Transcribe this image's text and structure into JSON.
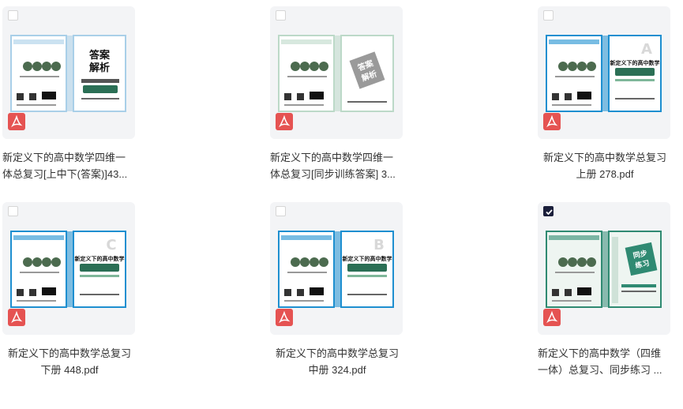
{
  "files": [
    {
      "line1": "新定义下的高中数学四维一",
      "line2": "体总复习[上中下(答案)]43...",
      "checked": false,
      "cover": "answer",
      "align": "left",
      "cover_title": [
        "答案",
        "解析"
      ],
      "cover_big": "",
      "border": "#a9cfe8",
      "back": "#ffffff"
    },
    {
      "line1": "新定义下的高中数学四维一",
      "line2": "体总复习[同步训练答案] 3...",
      "checked": false,
      "cover": "answer2",
      "align": "left",
      "cover_title": [
        "答案",
        "解析"
      ],
      "cover_big": "",
      "border": "#bcd9c8",
      "back": "#ffffff"
    },
    {
      "line1": "新定义下的高中数学总复习",
      "line2": "上册 278.pdf",
      "checked": false,
      "cover": "book",
      "align": "center",
      "cover_title": [
        "新定义下的高中数学"
      ],
      "cover_big": "A",
      "border": "#1e8fd0",
      "back": "#ffffff"
    },
    {
      "line1": "新定义下的高中数学总复习",
      "line2": "下册 448.pdf",
      "checked": false,
      "cover": "book",
      "align": "center",
      "cover_title": [
        "新定义下的高中数学"
      ],
      "cover_big": "C",
      "border": "#1e8fd0",
      "back": "#ffffff"
    },
    {
      "line1": "新定义下的高中数学总复习",
      "line2": "中册 324.pdf",
      "checked": false,
      "cover": "book",
      "align": "center",
      "cover_title": [
        "新定义下的高中数学"
      ],
      "cover_big": "B",
      "border": "#1e8fd0",
      "back": "#ffffff"
    },
    {
      "line1": "新定义下的高中数学（四维",
      "line2": "一体）总复习、同步练习 ...",
      "checked": true,
      "cover": "practice",
      "align": "left",
      "cover_title": [
        "同步",
        "练习"
      ],
      "cover_big": "",
      "border": "#2f8a72",
      "back": "#eef5f1"
    }
  ],
  "icons": {
    "checkbox": "checkbox-icon",
    "checked": "checkmark-icon",
    "file_type": "pdf-icon"
  },
  "colors": {
    "pdf_red": "#e55352",
    "check_dark": "#1b1f3b",
    "card_bg": "#f3f4f6"
  }
}
